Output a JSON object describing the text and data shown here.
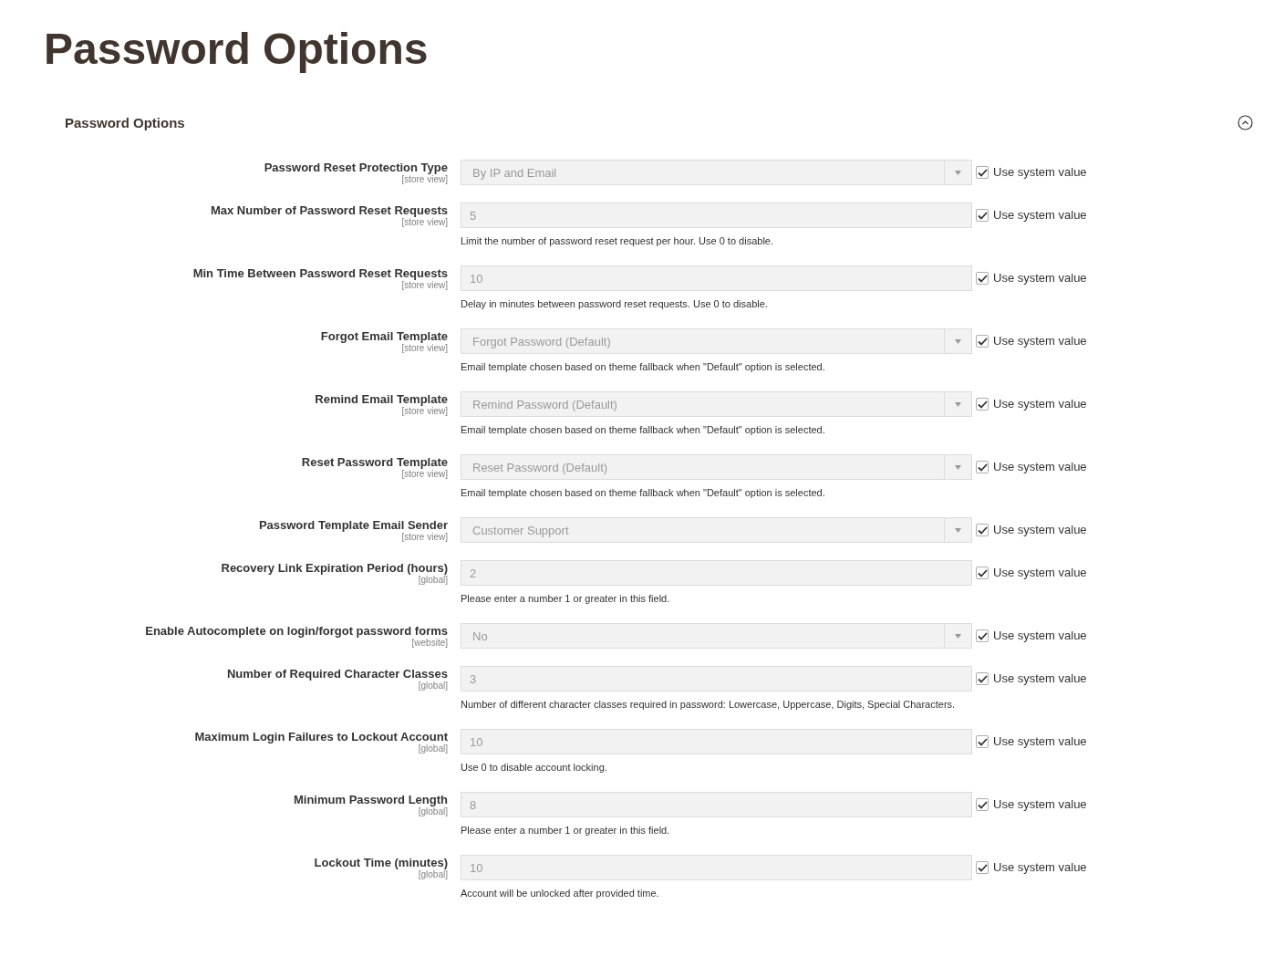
{
  "page_title": "Password Options",
  "section": {
    "title": "Password Options",
    "expanded": true
  },
  "fields": [
    {
      "label": "Password Reset Protection Type",
      "scope": "[store view]",
      "kind": "select",
      "value": "By IP and Email",
      "disabled": true,
      "use_system_value": true,
      "checkbox_label": "Use system value"
    },
    {
      "label": "Max Number of Password Reset Requests",
      "scope": "[store view]",
      "kind": "text",
      "value": "5",
      "disabled": true,
      "use_system_value": true,
      "checkbox_label": "Use system value",
      "note": "Limit the number of password reset request per hour. Use 0 to disable."
    },
    {
      "label": "Min Time Between Password Reset Requests",
      "scope": "[store view]",
      "kind": "text",
      "value": "10",
      "disabled": true,
      "use_system_value": true,
      "checkbox_label": "Use system value",
      "note": "Delay in minutes between password reset requests. Use 0 to disable."
    },
    {
      "label": "Forgot Email Template",
      "scope": "[store view]",
      "kind": "select",
      "value": "Forgot Password (Default)",
      "disabled": true,
      "use_system_value": true,
      "checkbox_label": "Use system value",
      "note": "Email template chosen based on theme fallback when \"Default\" option is selected."
    },
    {
      "label": "Remind Email Template",
      "scope": "[store view]",
      "kind": "select",
      "value": "Remind Password (Default)",
      "disabled": true,
      "use_system_value": true,
      "checkbox_label": "Use system value",
      "note": "Email template chosen based on theme fallback when \"Default\" option is selected."
    },
    {
      "label": "Reset Password Template",
      "scope": "[store view]",
      "kind": "select",
      "value": "Reset Password (Default)",
      "disabled": true,
      "use_system_value": true,
      "checkbox_label": "Use system value",
      "note": "Email template chosen based on theme fallback when \"Default\" option is selected."
    },
    {
      "label": "Password Template Email Sender",
      "scope": "[store view]",
      "kind": "select",
      "value": "Customer Support",
      "disabled": true,
      "use_system_value": true,
      "checkbox_label": "Use system value"
    },
    {
      "label": "Recovery Link Expiration Period (hours)",
      "scope": "[global]",
      "kind": "text",
      "value": "2",
      "disabled": true,
      "use_system_value": true,
      "checkbox_label": "Use system value",
      "note": "Please enter a number 1 or greater in this field."
    },
    {
      "label": "Enable Autocomplete on login/forgot password forms",
      "scope": "[website]",
      "kind": "select",
      "value": "No",
      "disabled": true,
      "use_system_value": true,
      "checkbox_label": "Use system value"
    },
    {
      "label": "Number of Required Character Classes",
      "scope": "[global]",
      "kind": "text",
      "value": "3",
      "disabled": true,
      "use_system_value": true,
      "checkbox_label": "Use system value",
      "note": "Number of different character classes required in password: Lowercase, Uppercase, Digits, Special Characters."
    },
    {
      "label": "Maximum Login Failures to Lockout Account",
      "scope": "[global]",
      "kind": "text",
      "value": "10",
      "disabled": true,
      "use_system_value": true,
      "checkbox_label": "Use system value",
      "note": "Use 0 to disable account locking."
    },
    {
      "label": "Minimum Password Length",
      "scope": "[global]",
      "kind": "text",
      "value": "8",
      "disabled": true,
      "use_system_value": true,
      "checkbox_label": "Use system value",
      "note": "Please enter a number 1 or greater in this field."
    },
    {
      "label": "Lockout Time (minutes)",
      "scope": "[global]",
      "kind": "text",
      "value": "10",
      "disabled": true,
      "use_system_value": true,
      "checkbox_label": "Use system value",
      "note": "Account will be unlocked after provided time."
    }
  ]
}
